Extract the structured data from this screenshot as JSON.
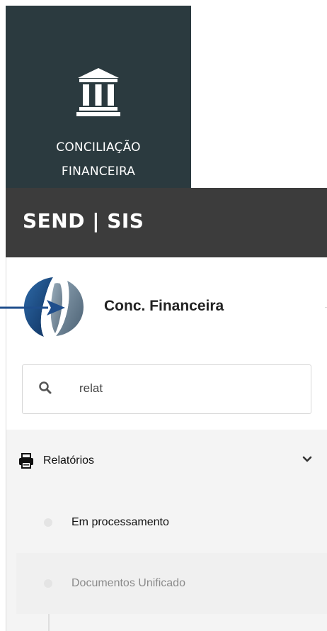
{
  "tile": {
    "line1": "CONCILIAÇÃO",
    "line2": "FINANCEIRA",
    "icon": "bank-icon"
  },
  "brand": {
    "text": "SEND | SIS"
  },
  "sidebar": {
    "app_name": "Conc. Financeira",
    "search": {
      "value": "relat",
      "icon": "search-icon"
    },
    "menu": {
      "label": "Relatórios",
      "icon": "printer-icon",
      "toggle_icon": "chevron-down-icon",
      "items": [
        {
          "label": "Em processamento"
        },
        {
          "label": "Documentos Unificado"
        }
      ]
    }
  },
  "colors": {
    "tile_bg": "#2b3a3f",
    "brand_bar_bg": "#3c3c3c",
    "arrow": "#1f4e8c"
  }
}
